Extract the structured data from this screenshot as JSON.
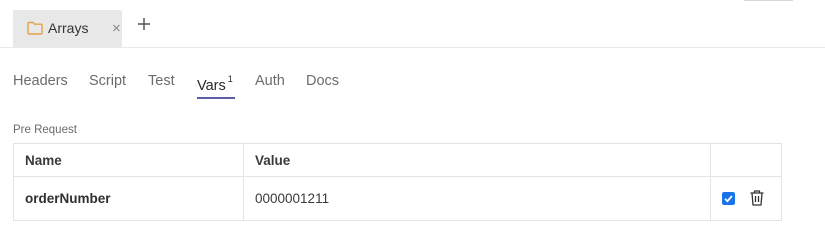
{
  "tab": {
    "label": "Arrays",
    "close": "×",
    "folder_color": "#e0a546"
  },
  "subtabs": [
    {
      "label": "Headers"
    },
    {
      "label": "Script"
    },
    {
      "label": "Test"
    },
    {
      "label": "Vars",
      "badge": "1",
      "active": true
    },
    {
      "label": "Auth"
    },
    {
      "label": "Docs"
    }
  ],
  "pre_request": {
    "section_label": "Pre Request",
    "columns": {
      "name": "Name",
      "value": "Value"
    },
    "rows": [
      {
        "name": "orderNumber",
        "value": "0000001211",
        "enabled": true
      }
    ]
  },
  "colors": {
    "accent": "#5b5fa8",
    "checkbox": "#1a73e8"
  }
}
